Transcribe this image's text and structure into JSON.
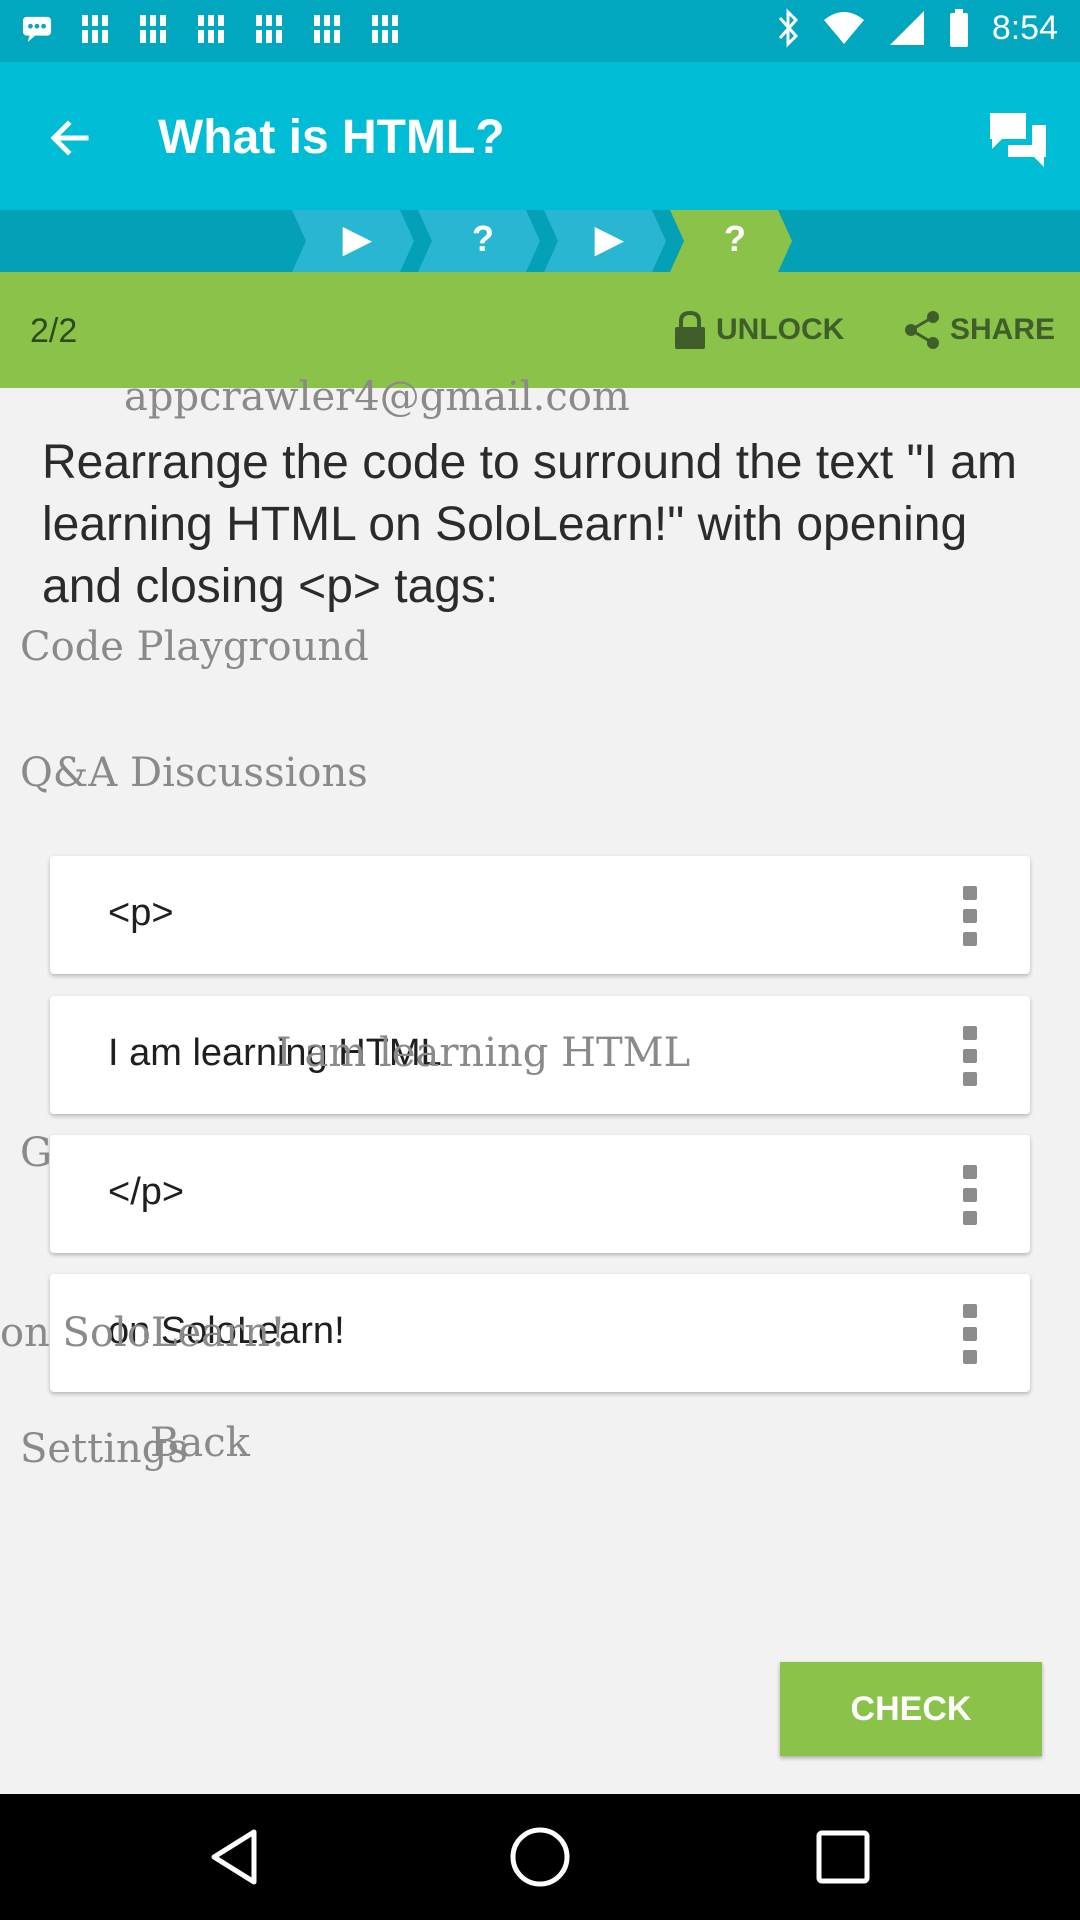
{
  "status_bar": {
    "time": "8:54",
    "left_icons": [
      "chat-bubble-icon",
      "image-icon",
      "image-icon",
      "image-icon",
      "image-icon",
      "image-icon",
      "image-icon"
    ],
    "right_icons": [
      "bluetooth-icon",
      "wifi-icon",
      "signal-icon",
      "battery-icon"
    ]
  },
  "app_bar": {
    "title": "What is HTML?",
    "background": "#00bcd4"
  },
  "step_bar": {
    "steps": [
      {
        "type": "play",
        "glyph": "▶"
      },
      {
        "type": "quiz",
        "glyph": "?"
      },
      {
        "type": "play",
        "glyph": "▶"
      },
      {
        "type": "quiz",
        "glyph": "?",
        "active": true
      }
    ]
  },
  "lesson_bar": {
    "count": "2/2",
    "unlock_label": "UNLOCK",
    "share_label": "SHARE",
    "background": "#8bc34a"
  },
  "overlay": {
    "email": "appcrawler4@gmail.com",
    "code_playground": "Code Playground",
    "qa_discussions": "Q&A Discussions",
    "learning_ghost": "I am learning HTML",
    "glossary": "Glossary",
    "on_sololearn_ghost": "on SoloLearn!",
    "settings": "Settings",
    "back": "Back"
  },
  "question": "Rearrange the code to surround the text \"I am learning HTML on SoloLearn!\" with opening and closing <p> tags:",
  "code_blocks": [
    {
      "text": "<p>"
    },
    {
      "text": "I am learning HTML"
    },
    {
      "text": "</p>"
    },
    {
      "text": "on SoloLearn!"
    }
  ],
  "check_label": "CHECK",
  "accent_green": "#8bc34a"
}
